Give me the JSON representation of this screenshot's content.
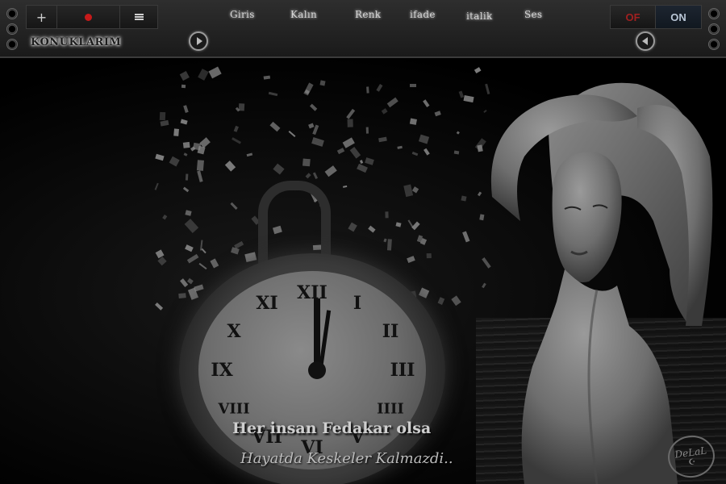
{
  "toolbar": {
    "add_label": "+",
    "menu": [
      "Giris",
      "Kalın",
      "Renk",
      "ifade",
      "italik",
      "Ses"
    ],
    "toggle": {
      "off_label": "OF",
      "on_label": "ON"
    },
    "guests_label": "KONUKLARIM"
  },
  "scene": {
    "caption_line1": "Her insan Fedakar olsa",
    "caption_line2": "Hayatda Keskeler Kalmazdi..",
    "signature": "DeLaL",
    "signature_symbol": "☪"
  },
  "clock": {
    "numerals": [
      "XII",
      "I",
      "II",
      "III",
      "IIII",
      "V",
      "VI",
      "VII",
      "VIII",
      "IX",
      "X",
      "XI"
    ]
  },
  "colors": {
    "record": "#c71a1a",
    "off": "#a02020",
    "on": "#b9c6d6"
  }
}
